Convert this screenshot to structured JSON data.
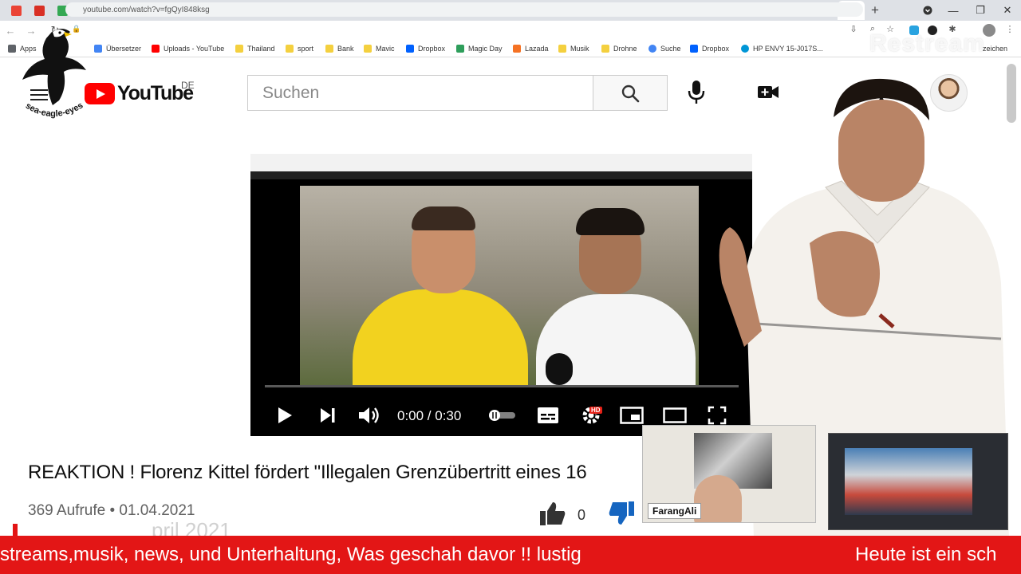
{
  "browser": {
    "url": "youtube.com/watch?v=fgQyI848ksg",
    "active_tab_label": "I",
    "bookmarks": [
      {
        "label": "Apps",
        "color": "#5f6368"
      },
      {
        "label": "Übersetzer",
        "color": "#4285f4"
      },
      {
        "label": "Uploads - YouTube",
        "color": "#ff0000"
      },
      {
        "label": "Thailand",
        "color": "#f4d03f"
      },
      {
        "label": "sport",
        "color": "#f4d03f"
      },
      {
        "label": "Bank",
        "color": "#f4d03f"
      },
      {
        "label": "Mavic",
        "color": "#f4d03f"
      },
      {
        "label": "Dropbox",
        "color": "#0061fe"
      },
      {
        "label": "Magic Day",
        "color": "#2e9e5b"
      },
      {
        "label": "Lazada",
        "color": "#f57224"
      },
      {
        "label": "Musik",
        "color": "#f4d03f"
      },
      {
        "label": "Drohne",
        "color": "#f4d03f"
      },
      {
        "label": "Suche",
        "color": "#4285f4"
      },
      {
        "label": "Dropbox",
        "color": "#0061fe"
      },
      {
        "label": "HP ENVY 15-J017S...",
        "color": "#0096d6"
      },
      {
        "label": "zeichen",
        "color": "#888888"
      }
    ]
  },
  "overlay": {
    "logo_caption": "sea-eagle-eyes",
    "restream_watermark": "Restream",
    "webcam_name": "FarangAli"
  },
  "youtube": {
    "wordmark": "YouTube",
    "region": "DE",
    "search_placeholder": "Suchen",
    "player": {
      "current_time": "0:00",
      "duration": "0:30",
      "time_display": "0:00 / 0:30",
      "progress": 0,
      "hd_badge": "HD"
    },
    "video": {
      "title": "REAKTION ! Florenz Kittel fördert \"Illegalen Grenzübertritt eines 16",
      "meta": "369 Aufrufe • 01.04.2021",
      "likes": "0",
      "ghost_text": "pril 2021"
    }
  },
  "ticker": {
    "segments": [
      "streams,musik, news, und Unterhaltung, Was geschah davor !! lustig",
      "Heute ist ein sch"
    ]
  },
  "colors": {
    "youtube_red": "#ff0000",
    "ticker_red": "#e31616",
    "dislike_blue": "#1565c0"
  }
}
